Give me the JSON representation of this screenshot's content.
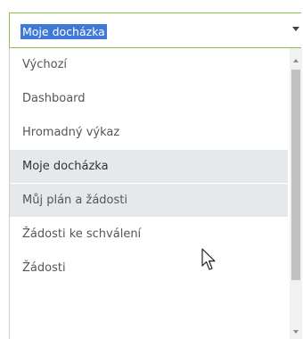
{
  "select": {
    "value": "Moje docházka"
  },
  "dropdown": {
    "options": [
      {
        "label": "Výchozí"
      },
      {
        "label": "Dashboard"
      },
      {
        "label": "Hromadný výkaz"
      },
      {
        "label": "Moje docházka",
        "selected": true
      },
      {
        "label": "Můj plán a žádosti",
        "hovered": true
      },
      {
        "label": "Žádosti ke schválení"
      },
      {
        "label": "Žádosti"
      }
    ]
  },
  "colors": {
    "accent_border": "#8bc34a",
    "selection_highlight": "#3f79d8",
    "option_highlight": "#e6e9ec"
  },
  "icons": {
    "select_arrow": "caret-down-icon",
    "scroll_up": "scroll-up-arrow-icon",
    "scroll_down": "scroll-down-arrow-icon",
    "cursor": "mouse-pointer-icon"
  }
}
